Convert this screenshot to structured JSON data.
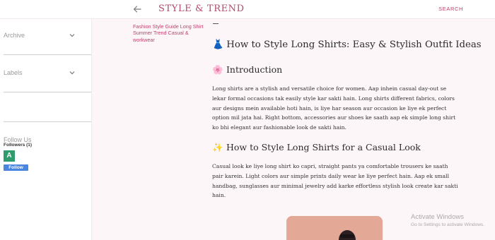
{
  "header": {
    "brand": "STYLE & TREND",
    "search_label": "SEARCH",
    "back_icon": "arrow-left-icon"
  },
  "sidebar": {
    "archive_label": "Archive",
    "labels_label": "Labels",
    "follow_title": "Follow Us",
    "followers_text": "Followers (1)",
    "avatar_letter": "A",
    "follow_button": "Follow"
  },
  "post": {
    "labels_text": "Fashion Style Guide Long Shirt Summer Trend Casual & workwear",
    "title": "How to Style Long Shirts: Easy & Stylish Outfit Ideas",
    "title_emoji": "👗",
    "sections": [
      {
        "emoji": "🌸",
        "heading": "Introduction",
        "body": "Long shirts are a stylish and versatile choice for women. Aap inhein casual day-out se lekar formal occasions tak easily style kar sakti hain. Long shirts different fabrics, colors aur designs mein available hoti hain, is liye har season aur occasion ke liye ek perfect option mil jata hai. Right bottom, accessories aur shoes ke saath aap ek simple long shirt ko bhi elegant aur fashionable look de sakti hain."
      },
      {
        "emoji": "✨",
        "heading": "How to Style Long Shirts for a Casual Look",
        "body": "Casual look ke liye long shirt ko capri, straight pants ya comfortable trousers ke saath pair karein. Light colors aur simple prints daily wear ke liye perfect hain. Aap ek small handbag, sunglasses aur minimal jewelry add karke effortless stylish look create kar sakti hain."
      }
    ]
  },
  "watermark": {
    "line1": "Activate Windows",
    "line2": "Go to Settings to activate Windows."
  },
  "colors": {
    "accent": "#c2406a",
    "brand": "#b04a6c",
    "follow_button": "#4a86e0",
    "avatar": "#2e9c6c"
  }
}
